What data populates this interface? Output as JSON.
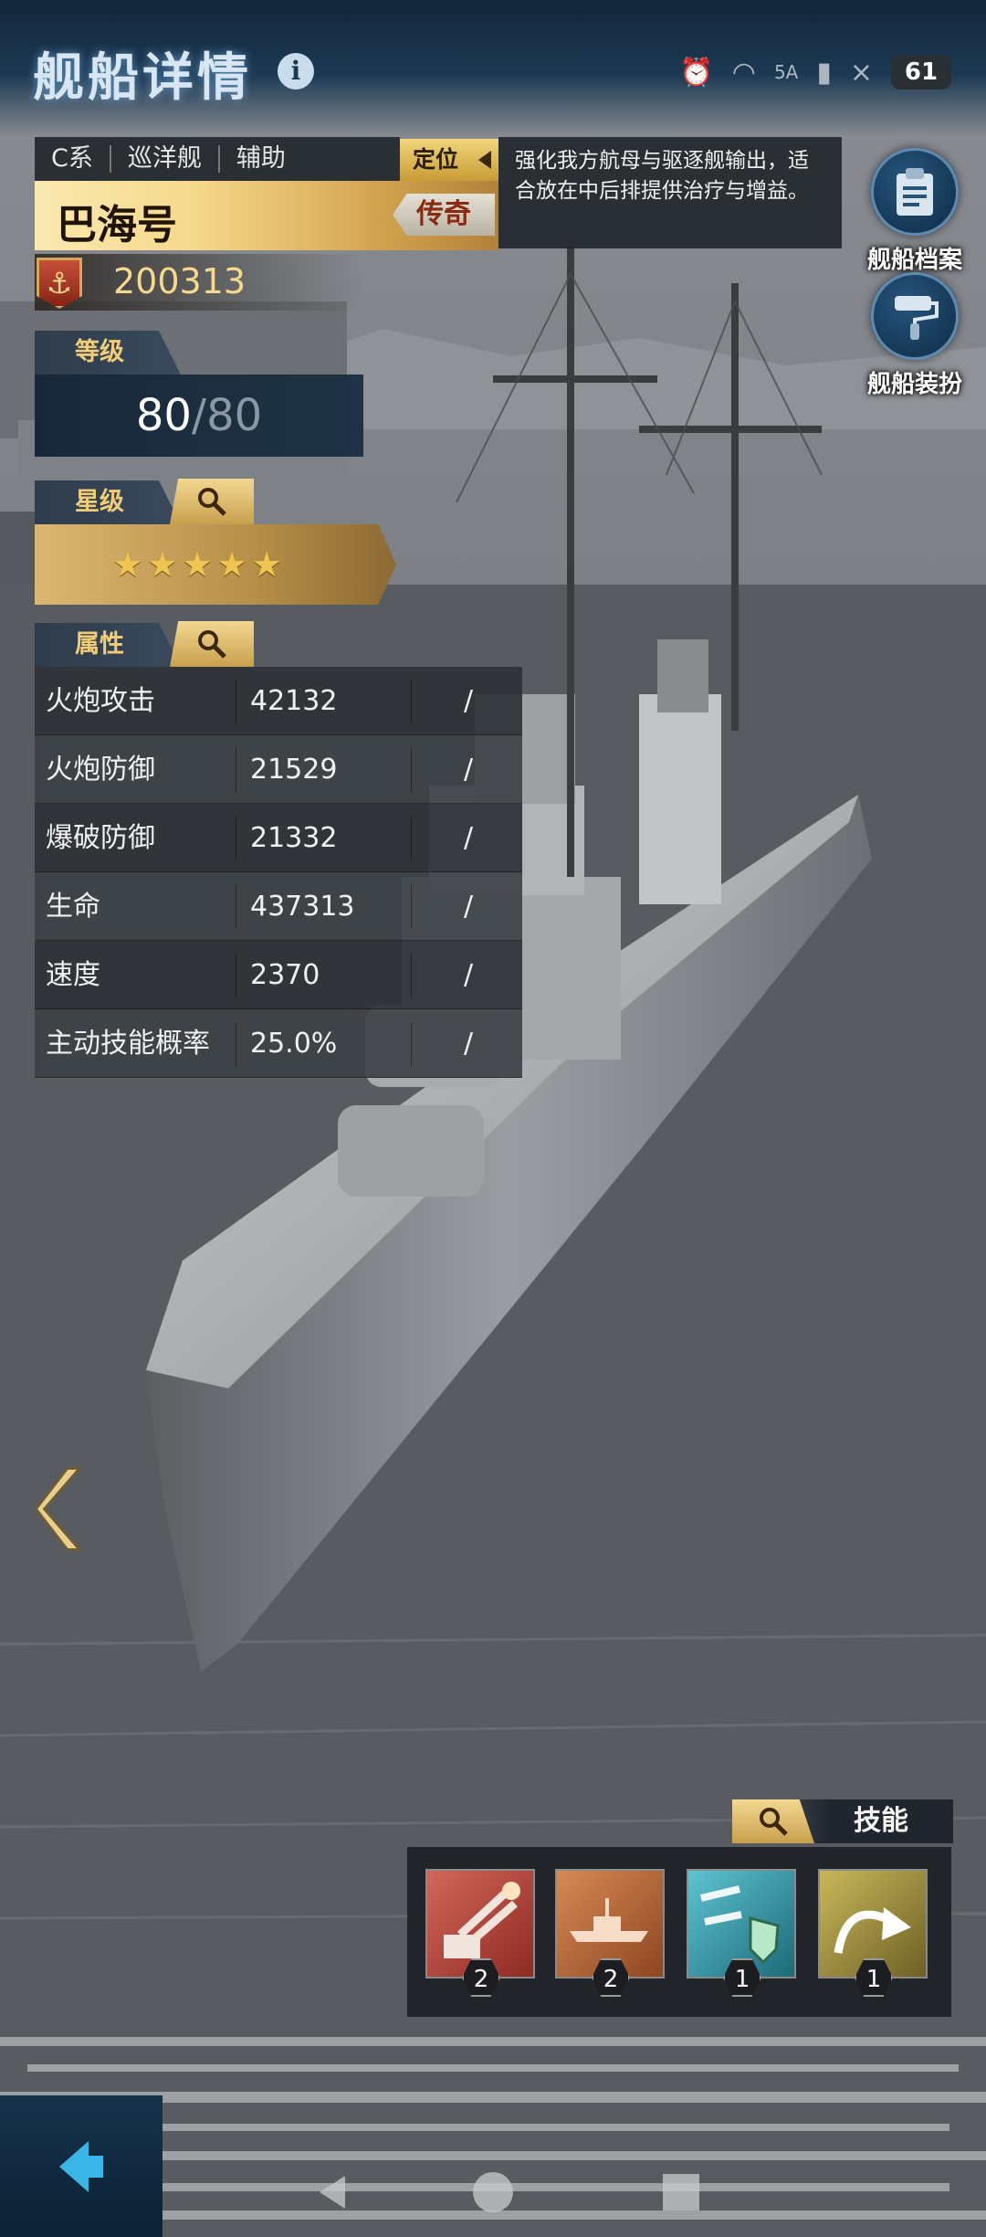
{
  "header": {
    "title": "舰船详情"
  },
  "status_bar": {
    "network": "5A",
    "battery": "61"
  },
  "ship": {
    "tags": [
      "C系",
      "巡洋舰",
      "辅助"
    ],
    "role_label": "定位",
    "role_description": "强化我方航母与驱逐舰输出，适合放在中后排提供治疗与增益。",
    "name": "巴海号",
    "rarity": "传奇",
    "id": "200313"
  },
  "side_buttons": {
    "archive": "舰船档案",
    "outfit": "舰船装扮"
  },
  "level": {
    "header": "等级",
    "current": "80",
    "max": "/80"
  },
  "stars": {
    "header": "星级",
    "count": 5
  },
  "attributes": {
    "header": "属性",
    "rows": [
      {
        "name": "火炮攻击",
        "value": "42132",
        "extra": "/"
      },
      {
        "name": "火炮防御",
        "value": "21529",
        "extra": "/"
      },
      {
        "name": "爆破防御",
        "value": "21332",
        "extra": "/"
      },
      {
        "name": "生命",
        "value": "437313",
        "extra": "/"
      },
      {
        "name": "速度",
        "value": "2370",
        "extra": "/"
      },
      {
        "name": "主动技能概率",
        "value": "25.0%",
        "extra": "/"
      }
    ]
  },
  "skills": {
    "header": "技能",
    "items": [
      {
        "icon": "cannon-icon",
        "level": "2",
        "color": "#b8443a"
      },
      {
        "icon": "fleet-icon",
        "level": "2",
        "color": "#b8663a"
      },
      {
        "icon": "shield-missile-icon",
        "level": "1",
        "color": "#2d8fa0"
      },
      {
        "icon": "curve-arrow-icon",
        "level": "1",
        "color": "#9a8a3a"
      }
    ]
  },
  "colors": {
    "gold": "#f1cd78",
    "panel": "#2e3237",
    "navy": "#1f3346"
  }
}
